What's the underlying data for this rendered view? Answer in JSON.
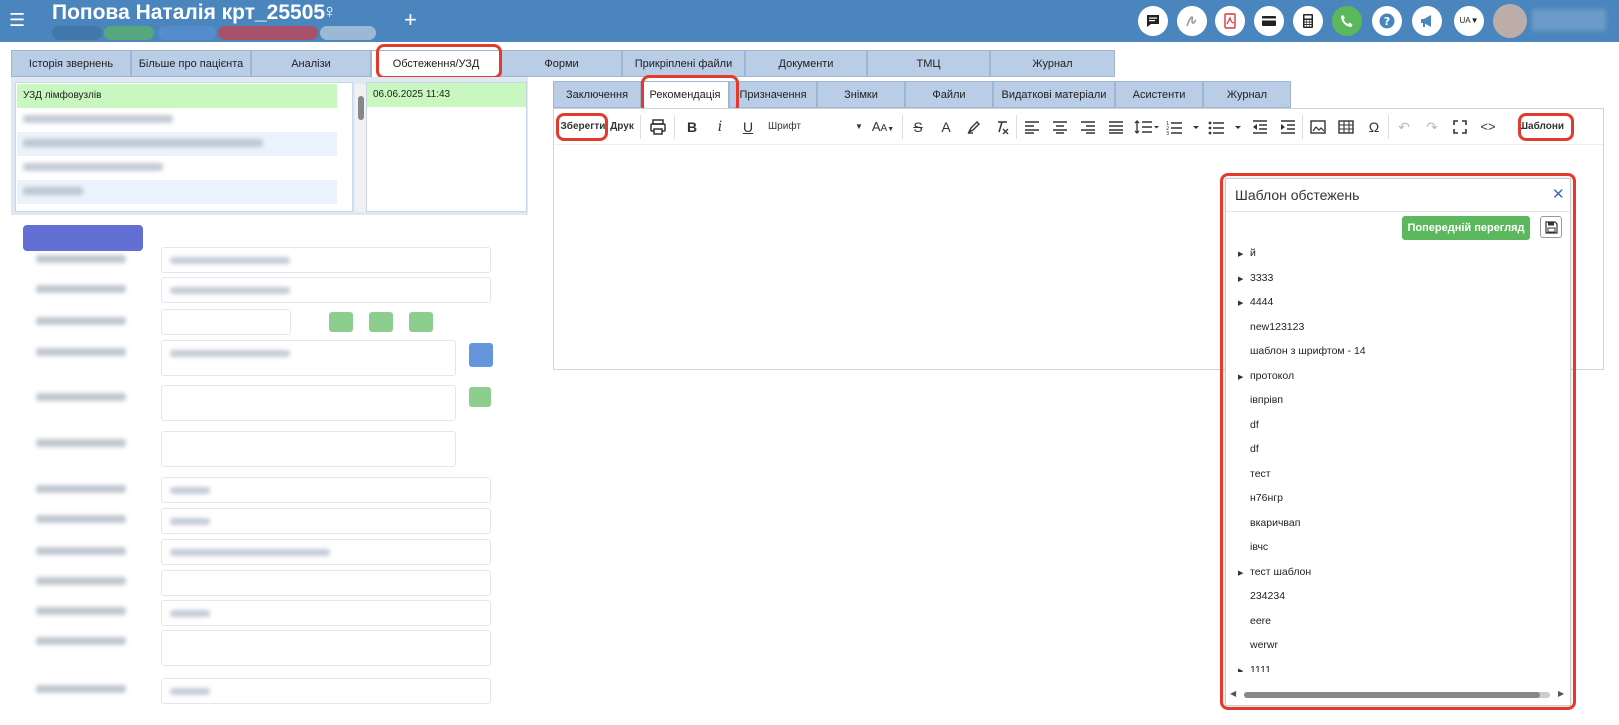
{
  "header": {
    "title": "Попова Наталія крт_25505",
    "lang": "UA",
    "icons": [
      "chat-icon",
      "signature-icon",
      "pdf-icon",
      "card-icon",
      "calculator-icon",
      "phone-icon",
      "help-icon",
      "megaphone-icon"
    ],
    "colors": {
      "bar": "#4a86bd",
      "phone": "#5cb85c",
      "pdf": "#d9363e"
    }
  },
  "main_tabs": [
    "Історія звернень",
    "Більше про пацієнта",
    "Аналізи",
    "Обстеження/УЗД",
    "Форми",
    "Прикріплені файли",
    "Документи",
    "ТМЦ",
    "Журнал"
  ],
  "active_main_tab": "Обстеження/УЗД",
  "exam_list": {
    "selected": "УЗД лімфовузлів",
    "date": "06.06.2025 11:43"
  },
  "sub_tabs": [
    "Заключення",
    "Рекомендація",
    "Призначення",
    "Знімки",
    "Файли",
    "Видаткові матеріали",
    "Асистенти",
    "Журнал"
  ],
  "active_sub_tab": "Рекомендація",
  "toolbar": {
    "save": "Зберегти",
    "print": "Друк",
    "font": "Шрифт",
    "templates": "Шаблони"
  },
  "templates": {
    "title": "Шаблон обстежень",
    "preview": "Попередній перегляд",
    "items": [
      {
        "label": "й",
        "expandable": true
      },
      {
        "label": "3333",
        "expandable": true
      },
      {
        "label": "4444",
        "expandable": true
      },
      {
        "label": "new123123",
        "expandable": false
      },
      {
        "label": "шаблон з шрифтом - 14",
        "expandable": false
      },
      {
        "label": "протокол",
        "expandable": true
      },
      {
        "label": "івпрівп",
        "expandable": false
      },
      {
        "label": "df",
        "expandable": false
      },
      {
        "label": "df",
        "expandable": false
      },
      {
        "label": "тест",
        "expandable": false
      },
      {
        "label": "н76нгр",
        "expandable": false
      },
      {
        "label": "вкаричвап",
        "expandable": false
      },
      {
        "label": "івчс",
        "expandable": false
      },
      {
        "label": "тест шаблон",
        "expandable": true
      },
      {
        "label": "234234",
        "expandable": false
      },
      {
        "label": "eere",
        "expandable": false
      },
      {
        "label": "werwr",
        "expandable": false
      },
      {
        "label": "1111",
        "expandable": true
      }
    ]
  },
  "highlight_color": "#e23b2d"
}
